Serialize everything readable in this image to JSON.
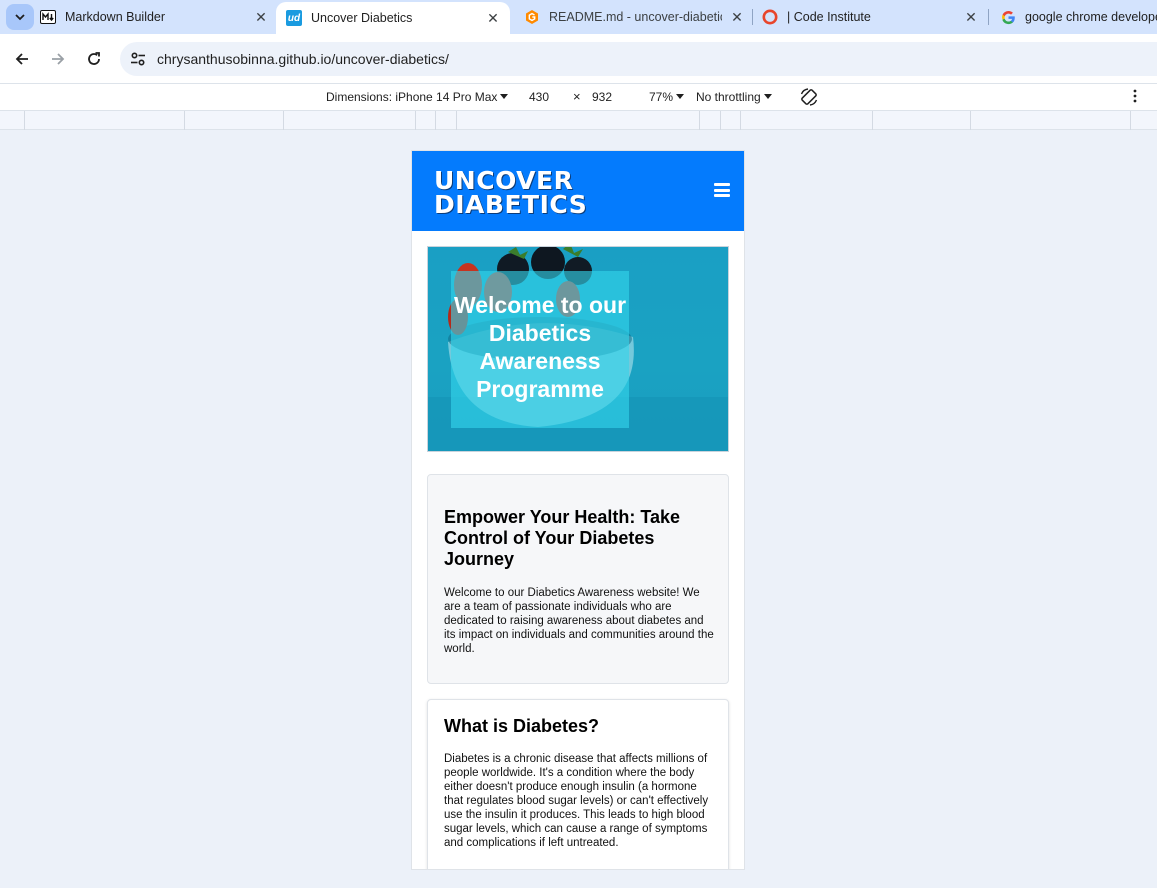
{
  "browser": {
    "tabs": [
      {
        "title": "Markdown Builder",
        "favicon": "markdown-icon",
        "active": false
      },
      {
        "title": "Uncover Diabetics",
        "favicon": "ud-icon",
        "active": true
      },
      {
        "title": "README.md - uncover-diabetic",
        "favicon": "gitpod-icon",
        "active": false
      },
      {
        "title": "| Code Institute",
        "favicon": "code-institute-icon",
        "active": false
      },
      {
        "title": "google chrome develope",
        "favicon": "google-icon",
        "active": false
      }
    ],
    "url": "chrysanthusobinna.github.io/uncover-diabetics/"
  },
  "devtools": {
    "dimensions_label": "Dimensions: iPhone 14 Pro Max",
    "width": "430",
    "times": "×",
    "height": "932",
    "zoom": "77%",
    "throttling": "No throttling"
  },
  "site": {
    "logo_line1": "UNCOVER",
    "logo_line2": "DIABETICS",
    "hero_title": "Welcome to our Diabetics Awareness Programme",
    "sections": [
      {
        "heading": "Empower Your Health: Take Control of Your Diabetes Journey",
        "body": "Welcome to our Diabetics Awareness website! We are a team of passionate individuals who are dedicated to raising awareness about diabetes and its impact on individuals and communities around the world."
      },
      {
        "heading": "What is Diabetes?",
        "body": "Diabetes is a chronic disease that affects millions of people worldwide. It's a condition where the body either doesn't produce enough insulin (a hormone that regulates blood sugar levels) or can't effectively use the insulin it produces. This leads to high blood sugar levels, which can cause a range of symptoms and complications if left untreated."
      }
    ]
  },
  "colors": {
    "site_header": "#047bfd",
    "tabstrip": "#d3e3fd",
    "page_bg": "#ecf1f9"
  }
}
